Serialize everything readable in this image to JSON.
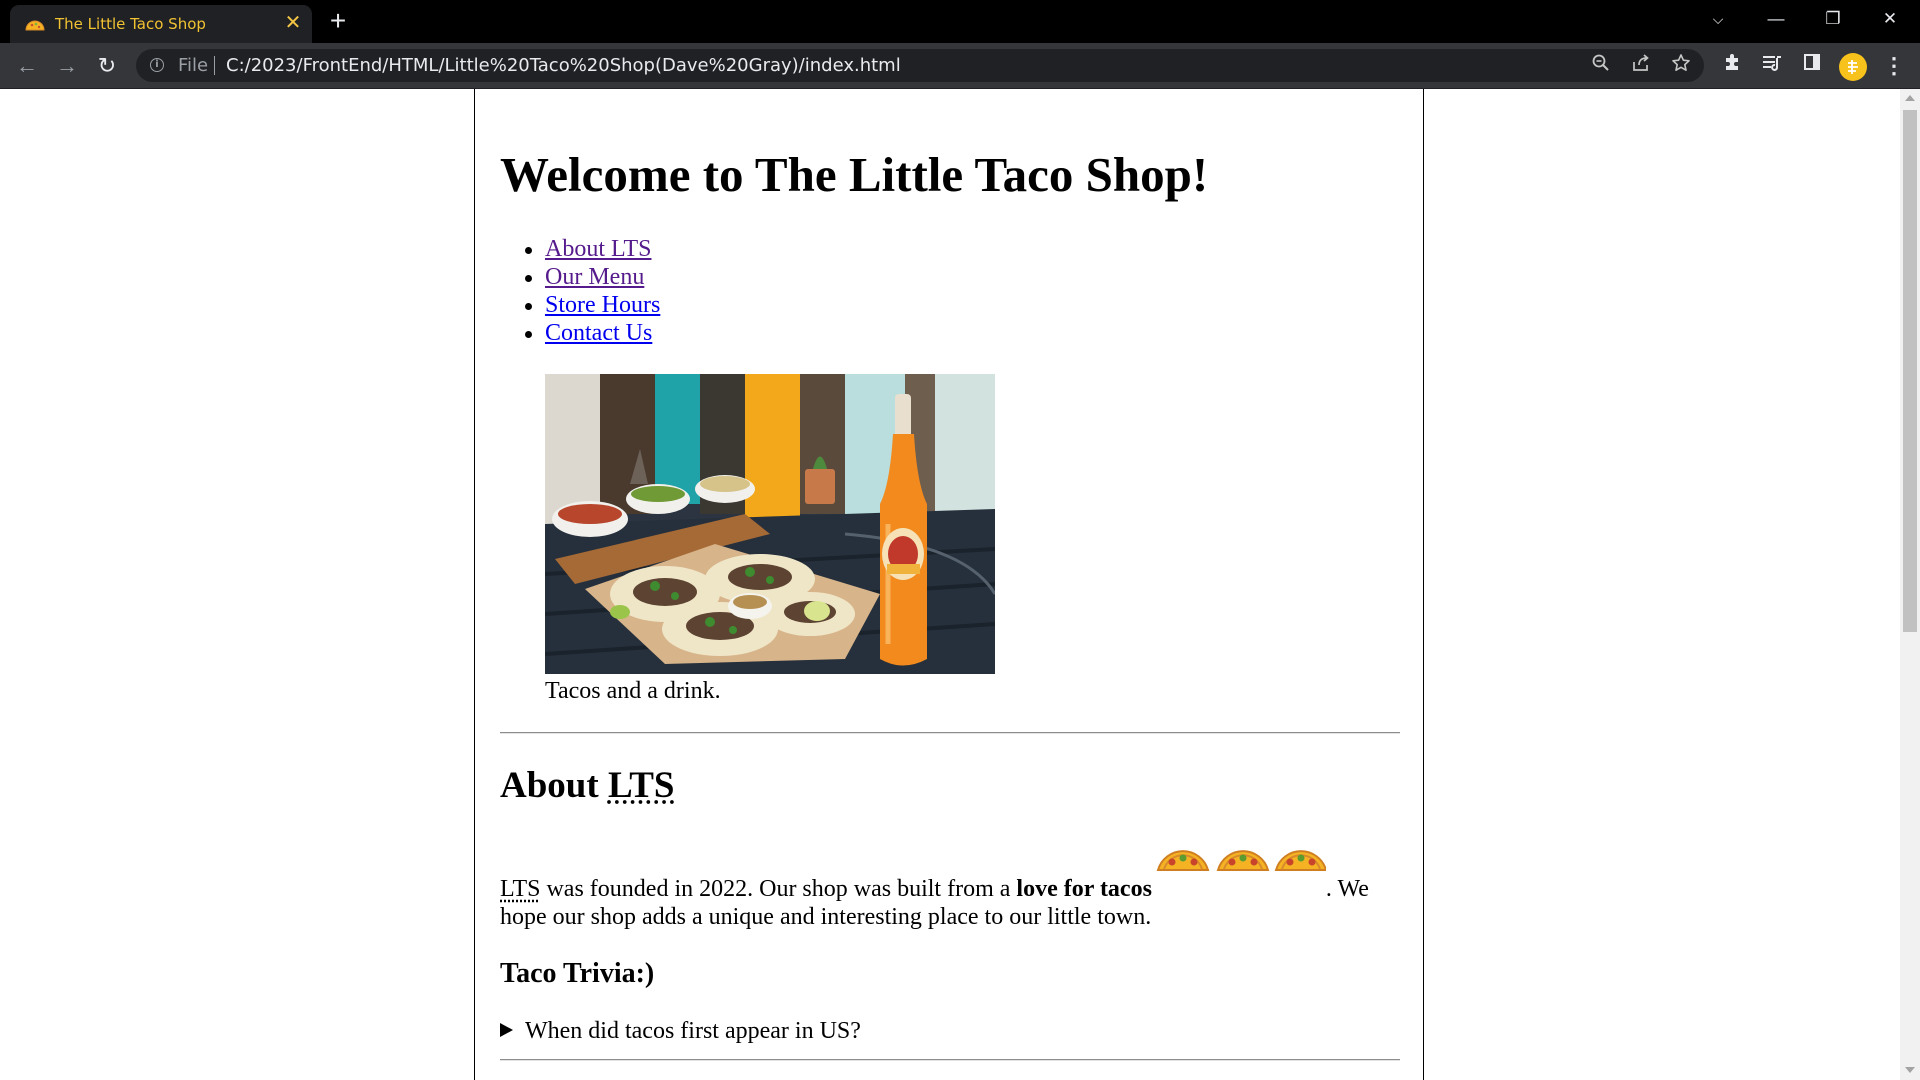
{
  "browser": {
    "tab_title": "The Little Taco Shop",
    "tab_close": "✕",
    "new_tab": "+",
    "window_controls": {
      "tab_search": "⌵",
      "minimize": "—",
      "restore": "❐",
      "close": "✕"
    },
    "back": "←",
    "forward": "→",
    "reload": "↻",
    "scheme_label": "File",
    "url": "C:/2023/FrontEnd/HTML/Little%20Taco%20Shop(Dave%20Gray)/index.html",
    "icons": [
      "zoom-icon",
      "share-icon",
      "bookmark-star-icon",
      "extensions-icon",
      "reading-list-icon",
      "side-panel-icon",
      "profile-avatar",
      "menu-icon"
    ],
    "menu_glyph": "⋮"
  },
  "page": {
    "title": "Welcome to The Little Taco Shop!",
    "nav": [
      {
        "label": "About LTS",
        "visited": true
      },
      {
        "label": "Our Menu",
        "visited": true
      },
      {
        "label": "Store Hours",
        "visited": false
      },
      {
        "label": "Contact Us",
        "visited": false
      }
    ],
    "hero_caption": "Tacos and a drink.",
    "about": {
      "heading_word": "About",
      "heading_abbr": "LTS",
      "para_abbr": "LTS",
      "para_text_1": " was founded in 2022. Our shop was built from a ",
      "para_bold": "love for tacos",
      "para_text_2": ". We hope our shop adds a unique and interesting place to our little town."
    },
    "trivia": {
      "heading": "Taco Trivia:)",
      "question": "When did tacos first appear in US?"
    }
  },
  "colors": {
    "visited_link": "#551a8b",
    "unvisited_link": "#0000ee",
    "tab_title": "#f1c232"
  }
}
